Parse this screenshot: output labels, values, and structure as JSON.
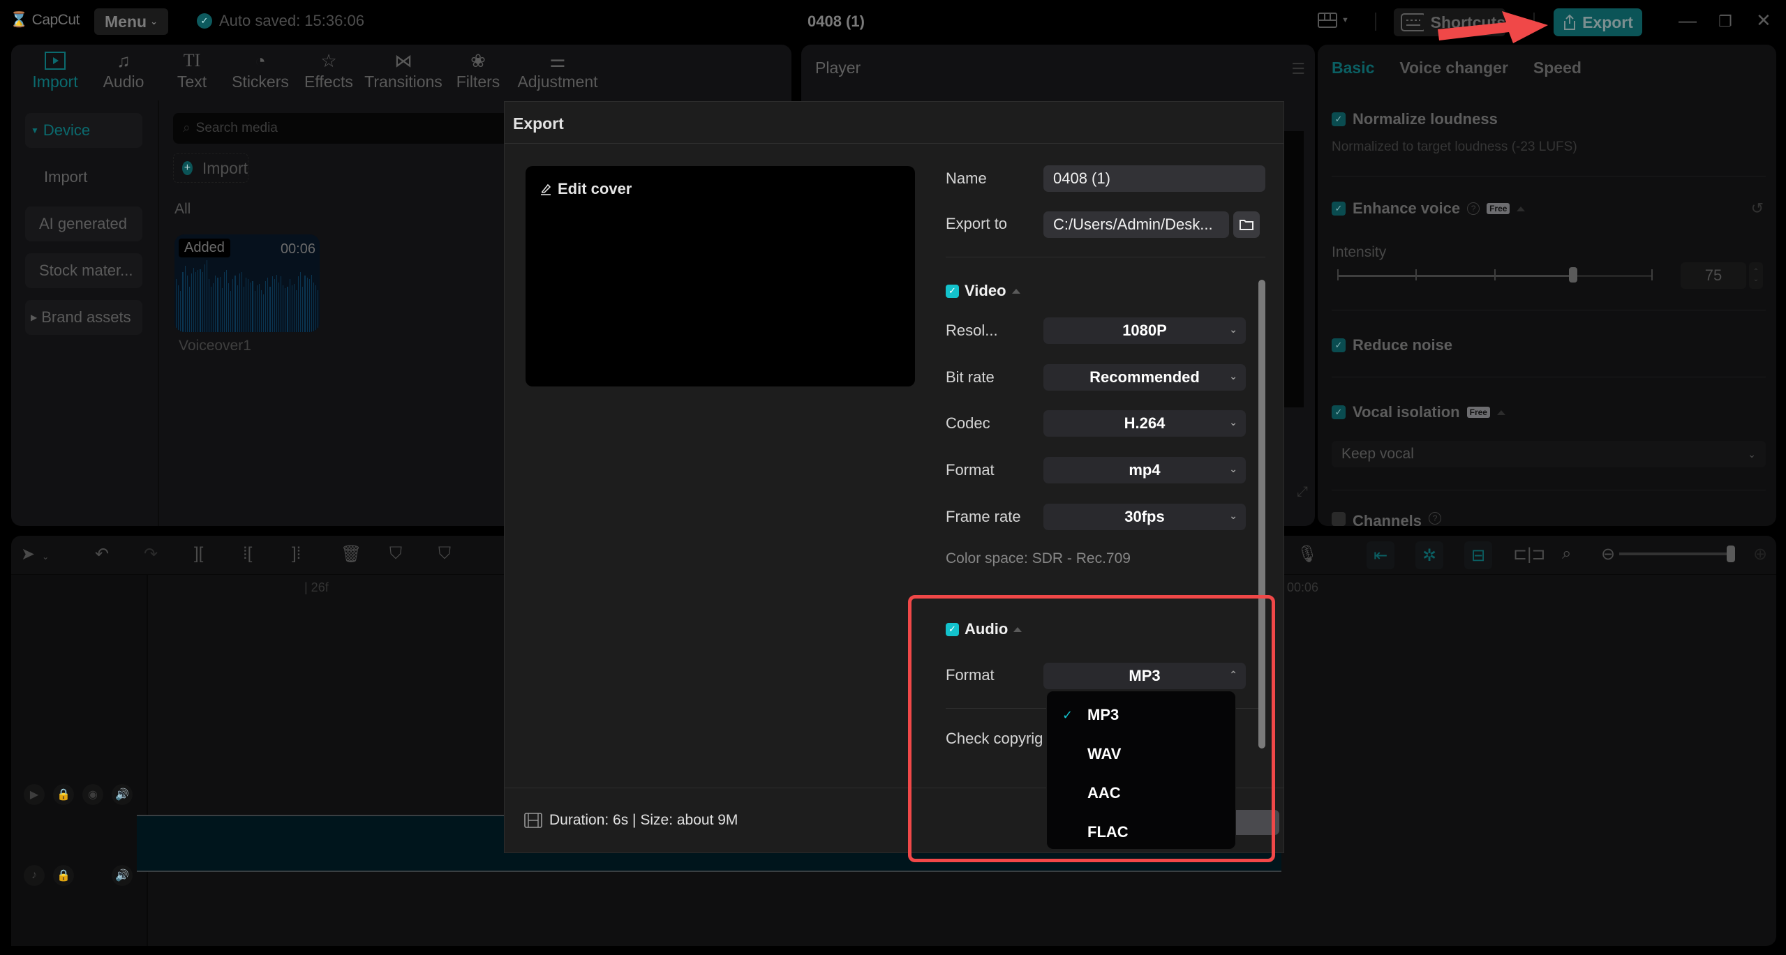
{
  "app": {
    "logo": "CapCut",
    "menu_label": "Menu",
    "autosave": "Auto saved: 15:36:06",
    "project_title": "0408 (1)",
    "shortcuts_label": "Shortcuts",
    "export_label": "Export",
    "window_controls": [
      "minimize-icon",
      "restore-icon",
      "close-icon"
    ]
  },
  "toolbar": {
    "tabs": [
      {
        "label": "Import",
        "icon": "import-icon",
        "active": true
      },
      {
        "label": "Audio",
        "icon": "audio-icon"
      },
      {
        "label": "Text",
        "icon": "text-icon"
      },
      {
        "label": "Stickers",
        "icon": "stickers-icon"
      },
      {
        "label": "Effects",
        "icon": "effects-icon"
      },
      {
        "label": "Transitions",
        "icon": "transitions-icon"
      },
      {
        "label": "Filters",
        "icon": "filters-icon"
      },
      {
        "label": "Adjustment",
        "icon": "adjustment-icon"
      }
    ]
  },
  "sidebar": {
    "items": [
      {
        "label": "Device",
        "expanded": true,
        "active": true
      },
      {
        "label": "Import"
      },
      {
        "label": "AI generated"
      },
      {
        "label": "Stock mater..."
      },
      {
        "label": "Brand assets",
        "collapsed": true
      }
    ]
  },
  "media": {
    "search_placeholder": "Search media",
    "import_label": "Import",
    "filter_label": "All",
    "items": [
      {
        "badge": "Added",
        "duration": "00:06",
        "name": "Voiceover1"
      }
    ]
  },
  "player": {
    "title": "Player"
  },
  "properties": {
    "tabs": [
      {
        "label": "Basic",
        "active": true
      },
      {
        "label": "Voice changer"
      },
      {
        "label": "Speed"
      }
    ],
    "normalize": {
      "label": "Normalize loudness",
      "checked": true,
      "description": "Normalized to target loudness (-23 LUFS)"
    },
    "enhance": {
      "label": "Enhance voice",
      "checked": true,
      "badge": "Free",
      "intensity_label": "Intensity",
      "intensity_value": "75",
      "intensity_fraction": 0.75
    },
    "reduce_noise": {
      "label": "Reduce noise",
      "checked": true
    },
    "vocal_isolation": {
      "label": "Vocal isolation",
      "checked": true,
      "badge": "Free",
      "selected": "Keep vocal"
    },
    "channels": {
      "label": "Channels",
      "checked": false
    }
  },
  "timeline": {
    "ruler_labels": [
      "| 26f",
      "00:06"
    ]
  },
  "export_dialog": {
    "title": "Export",
    "edit_cover": "Edit cover",
    "name_label": "Name",
    "name_value": "0408 (1)",
    "export_to_label": "Export to",
    "export_to_value": "C:/Users/Admin/Desk...",
    "video": {
      "label": "Video",
      "checked": true,
      "fields": [
        {
          "label": "Resol...",
          "value": "1080P"
        },
        {
          "label": "Bit rate",
          "value": "Recommended"
        },
        {
          "label": "Codec",
          "value": "H.264"
        },
        {
          "label": "Format",
          "value": "mp4"
        },
        {
          "label": "Frame rate",
          "value": "30fps"
        }
      ],
      "color_space": "Color space: SDR - Rec.709"
    },
    "audio": {
      "label": "Audio",
      "checked": true,
      "format_label": "Format",
      "format_value": "MP3",
      "format_options": [
        {
          "label": "MP3",
          "selected": true
        },
        {
          "label": "WAV"
        },
        {
          "label": "AAC"
        },
        {
          "label": "FLAC"
        }
      ]
    },
    "copyright_label": "Check copyrig",
    "footer_info": "Duration: 6s | Size: about 9M"
  },
  "colors": {
    "accent": "#13c2cc",
    "highlight_box": "#f04848",
    "export_button": "#0b5457"
  }
}
